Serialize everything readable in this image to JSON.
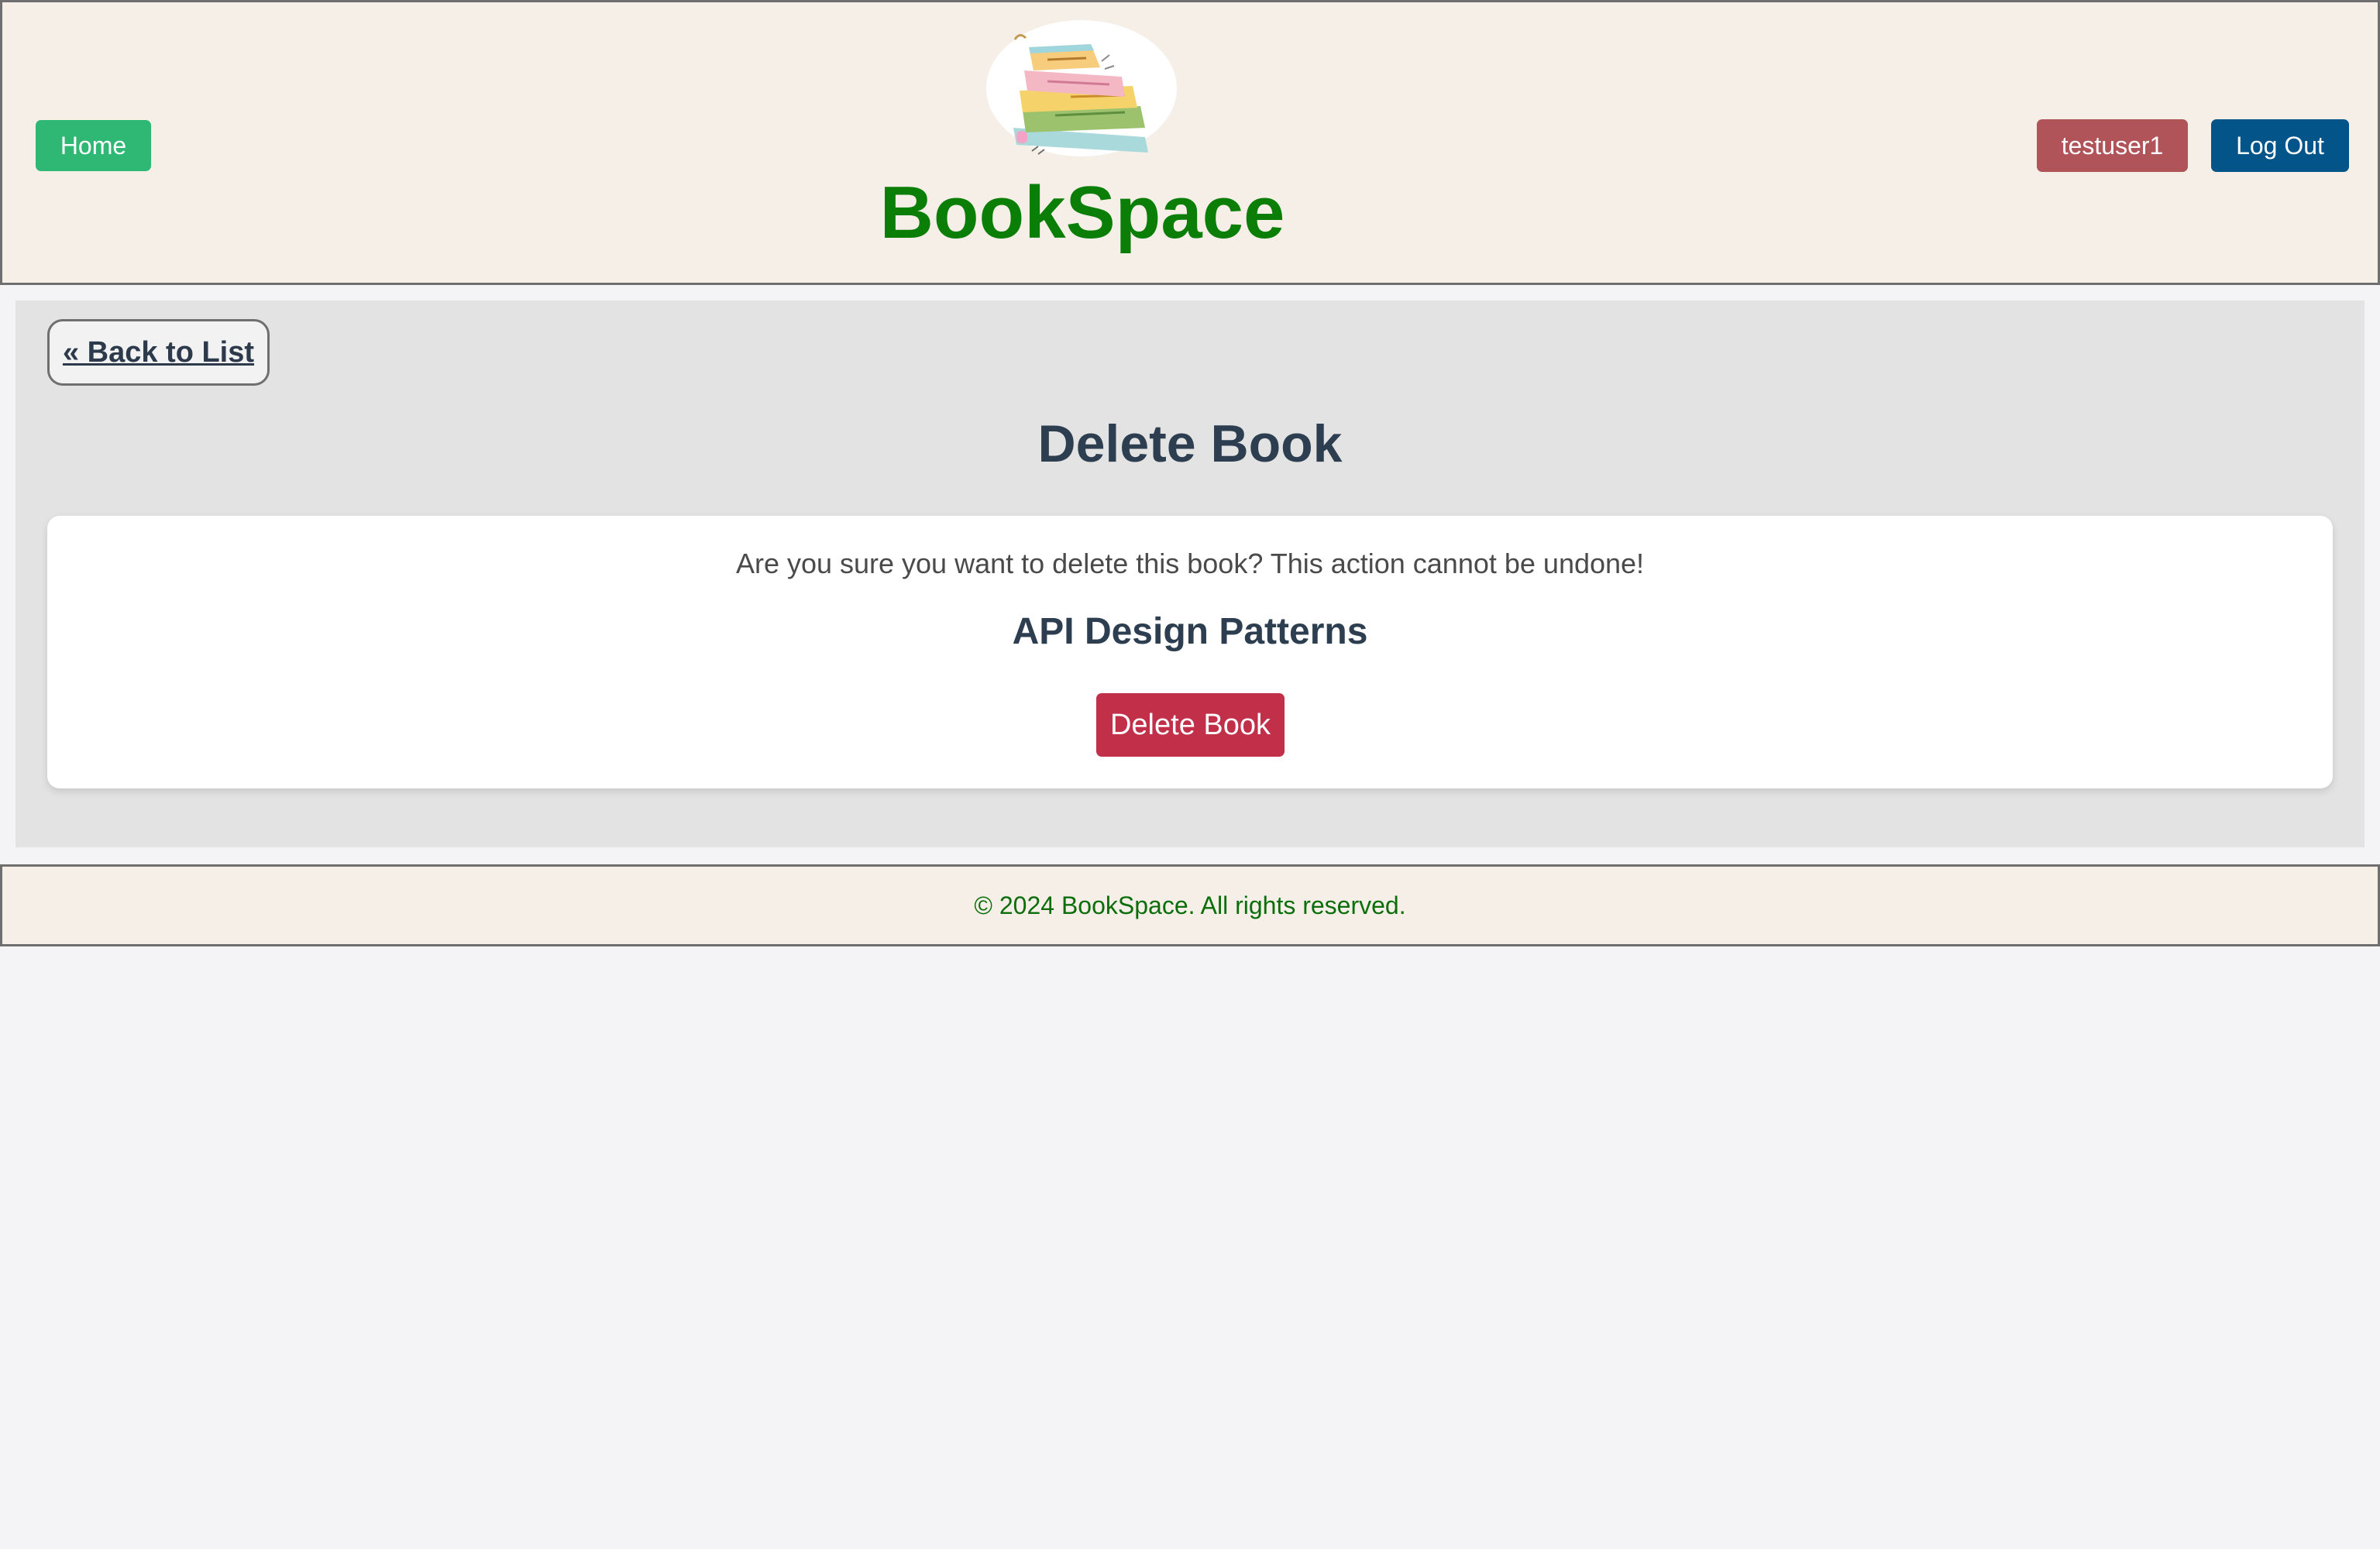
{
  "header": {
    "home_label": "Home",
    "brand_name": "BookSpace",
    "user_label": "testuser1",
    "logout_label": "Log Out"
  },
  "main": {
    "back_label": "« Back to List",
    "title": "Delete Book",
    "confirm_text": "Are you sure you want to delete this book? This action cannot be undone!",
    "book_title": "API Design Patterns",
    "delete_label": "Delete Book"
  },
  "footer": {
    "copyright": "© 2024 BookSpace. All rights reserved."
  },
  "colors": {
    "header_bg": "#f5efe8",
    "brand_green": "#0a7e07",
    "home_button": "#2fb873",
    "user_button": "#b1545a",
    "logout_button": "#035488",
    "delete_button": "#c12f48",
    "title_text": "#2c3e50"
  },
  "icons": {
    "logo": "stacked-books-logo"
  }
}
